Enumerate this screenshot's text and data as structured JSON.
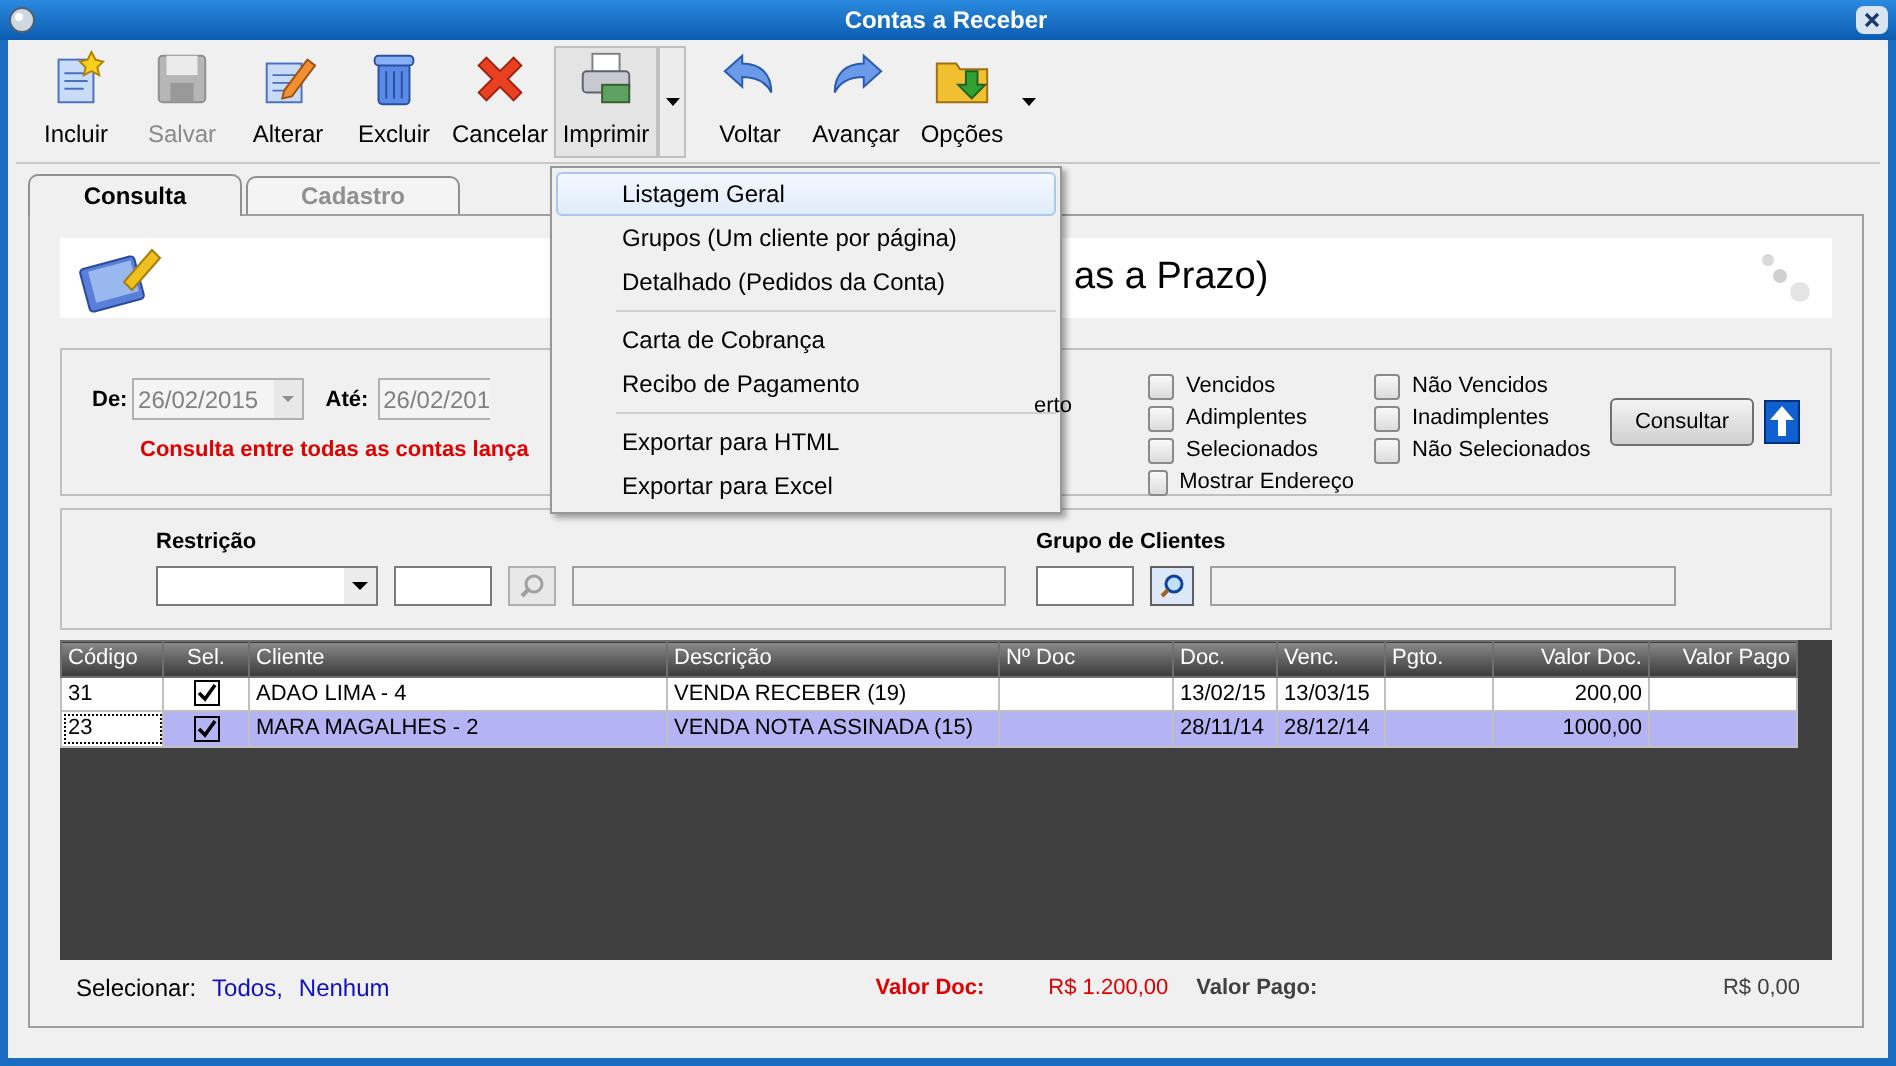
{
  "window": {
    "title": "Contas a Receber"
  },
  "toolbar": [
    {
      "label": "Incluir",
      "kind": "new",
      "disabled": false,
      "pressed": false,
      "dropdown": false
    },
    {
      "label": "Salvar",
      "kind": "save",
      "disabled": true,
      "pressed": false,
      "dropdown": false
    },
    {
      "label": "Alterar",
      "kind": "edit",
      "disabled": false,
      "pressed": false,
      "dropdown": false
    },
    {
      "label": "Excluir",
      "kind": "delete",
      "disabled": false,
      "pressed": false,
      "dropdown": false
    },
    {
      "label": "Cancelar",
      "kind": "cancel",
      "disabled": false,
      "pressed": false,
      "dropdown": false
    },
    {
      "label": "Imprimir",
      "kind": "print",
      "disabled": false,
      "pressed": true,
      "dropdown": true
    },
    {
      "label": "Voltar",
      "kind": "back",
      "disabled": false,
      "pressed": false,
      "dropdown": false
    },
    {
      "label": "Avançar",
      "kind": "forward",
      "disabled": false,
      "pressed": false,
      "dropdown": false
    },
    {
      "label": "Opções",
      "kind": "options",
      "disabled": false,
      "pressed": false,
      "dropdown": true
    }
  ],
  "print_menu": {
    "groups": [
      [
        {
          "label": "Listagem Geral",
          "selected": true
        },
        {
          "label": "Grupos (Um cliente por página)",
          "selected": false
        },
        {
          "label": "Detalhado (Pedidos da Conta)",
          "selected": false
        }
      ],
      [
        {
          "label": "Carta de Cobrança",
          "selected": false
        },
        {
          "label": "Recibo de Pagamento",
          "selected": false
        }
      ],
      [
        {
          "label": "Exportar para HTML",
          "selected": false
        },
        {
          "label": "Exportar para Excel",
          "selected": false
        }
      ]
    ]
  },
  "tabs": [
    {
      "label": "Consulta",
      "selected": true
    },
    {
      "label": "Cadastro",
      "selected": false
    }
  ],
  "header": {
    "title": "as a Prazo)"
  },
  "filters": {
    "from_label": "De:",
    "from_value": "26/02/2015",
    "to_label": "Até:",
    "to_value": "26/02/201",
    "note": "Consulta entre todas as contas lança",
    "fragment": "erto",
    "checkbox_columns": [
      [
        {
          "label": "Vencidos",
          "checked": false
        },
        {
          "label": "Adimplentes",
          "checked": false
        },
        {
          "label": "Selecionados",
          "checked": false
        },
        {
          "label": "Mostrar Endereço",
          "checked": false
        }
      ],
      [
        {
          "label": "Não Vencidos",
          "checked": false
        },
        {
          "label": "Inadimplentes",
          "checked": false
        },
        {
          "label": "Não Selecionados",
          "checked": false
        }
      ]
    ],
    "button": "Consultar"
  },
  "restriction": {
    "label": "Restrição",
    "group_label": "Grupo de Clientes"
  },
  "table": {
    "columns": [
      "Código",
      "Sel.",
      "Cliente",
      "Descrição",
      "Nº Doc",
      "Doc.",
      "Venc.",
      "Pgto.",
      "Valor Doc.",
      "Valor Pago"
    ],
    "rows": [
      {
        "cells": [
          "31",
          null,
          "ADAO LIMA - 4",
          "VENDA RECEBER (19)",
          null,
          "13/02/15",
          "13/03/15",
          null,
          "200,00",
          null
        ],
        "checked": true,
        "selected": false
      },
      {
        "cells": [
          "23",
          null,
          "MARA MAGALHES - 2",
          "VENDA NOTA ASSINADA (15)",
          null,
          "28/11/14",
          "28/12/14",
          null,
          "1000,00",
          null
        ],
        "checked": true,
        "selected": true
      }
    ]
  },
  "footer": {
    "select_label": "Selecionar:",
    "links": [
      "Todos,",
      "Nenhum"
    ],
    "total_doc_label": "Valor Doc:",
    "total_doc": "R$ 1.200,00",
    "total_paid_label": "Valor Pago:",
    "total_paid": "R$ 0,00"
  }
}
